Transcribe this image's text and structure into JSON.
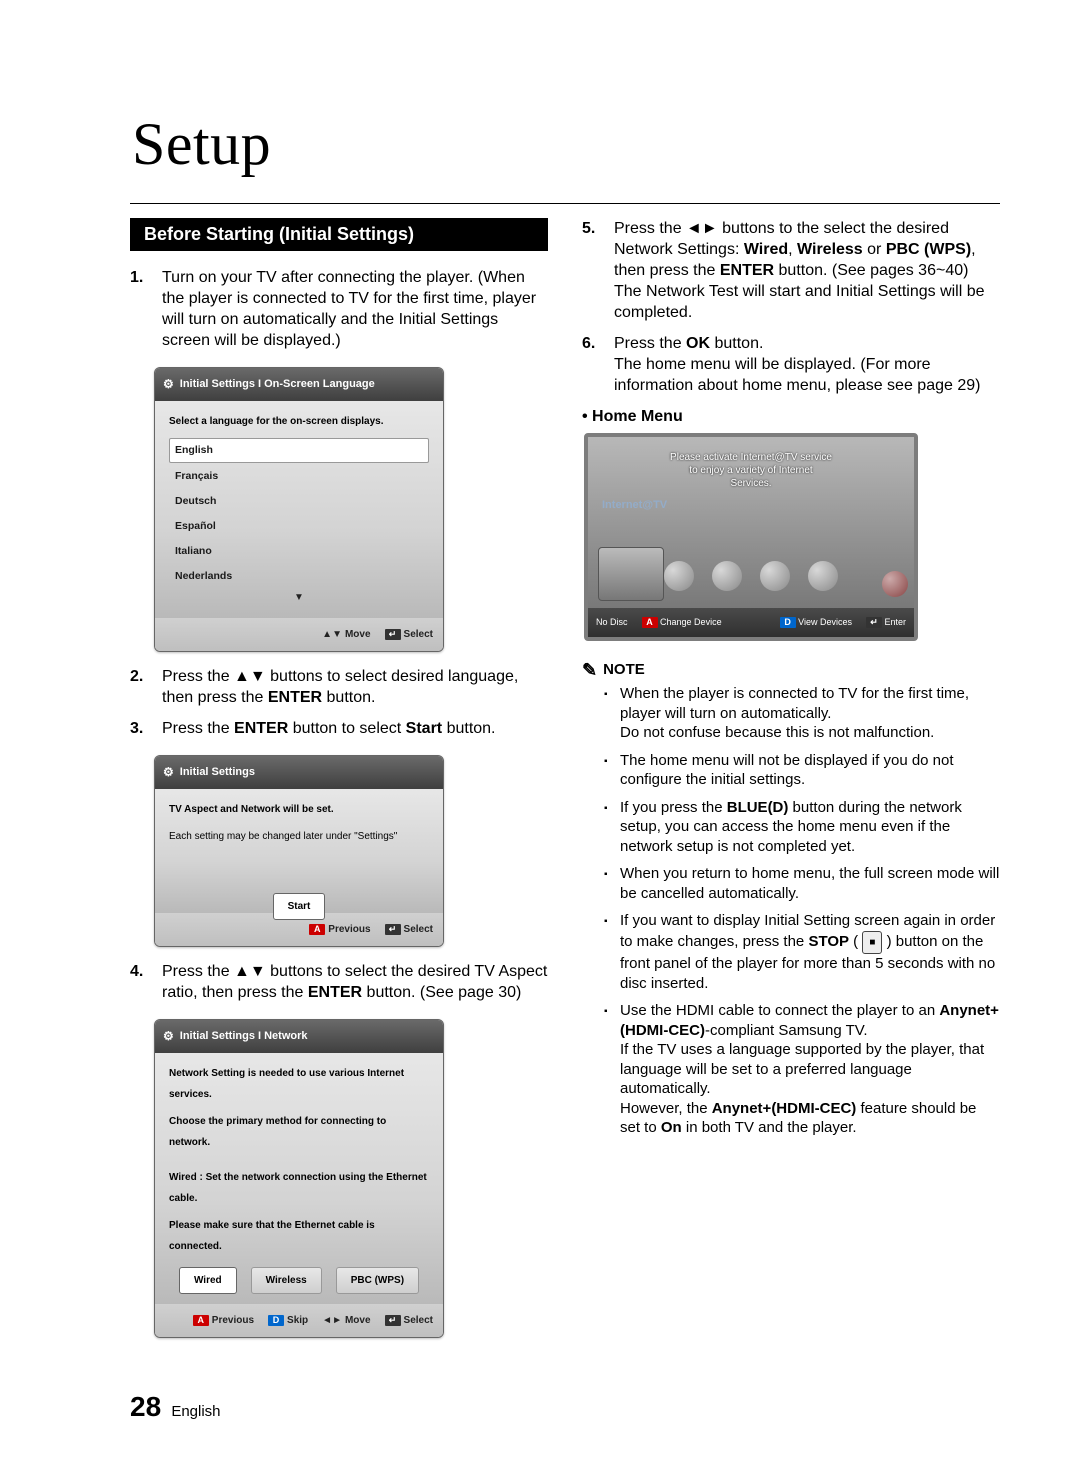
{
  "page": {
    "title": "Setup",
    "number": "28",
    "language": "English"
  },
  "section_heading": "Before Starting (Initial Settings)",
  "steps_left": [
    "Turn on your TV after connecting the player. (When the player is connected to TV for the first time, player will turn on automatically and the Initial Settings screen will be displayed.)",
    "Press the ▲▼ buttons to select desired language, then press the ENTER button.",
    "Press the ENTER button to select Start button.",
    "Press the ▲▼ buttons to select the desired TV Aspect ratio, then press the ENTER button. (See page 30)"
  ],
  "steps_right": [
    "Press the ◄► buttons to the select the desired Network Settings: Wired, Wireless or PBC (WPS), then press the ENTER button. (See pages 36~40)  The Network Test will start and Initial Settings will be completed.",
    "Press the OK button.  The home menu will be displayed. (For more information about home menu, please see page 29)"
  ],
  "bold_words": {
    "enter": "ENTER",
    "start": "Start",
    "ok": "OK",
    "wired": "Wired",
    "wireless": "Wireless",
    "pbc": "PBC (WPS)",
    "blue_d": "BLUE(D)",
    "stop": "STOP",
    "anynet": "Anynet+(HDMI-CEC)",
    "on": "On"
  },
  "osd1": {
    "title": "Initial Settings I On-Screen Language",
    "msg": "Select a language for the on-screen displays.",
    "languages": [
      "English",
      "Français",
      "Deutsch",
      "Español",
      "Italiano",
      "Nederlands"
    ],
    "footer_move": "Move",
    "footer_select": "Select"
  },
  "osd2": {
    "title": "Initial Settings",
    "msg1": "TV Aspect and Network will be set.",
    "msg2": "Each setting may be changed later under \"Settings\"",
    "btn_start": "Start",
    "footer_previous": "Previous",
    "footer_select": "Select"
  },
  "osd3": {
    "title": "Initial Settings I Network",
    "msg1": "Network Setting is needed to use various Internet services.",
    "msg2": "Choose the primary method for connecting to network.",
    "msg3": "Wired : Set the network connection using the Ethernet cable.",
    "msg4": "Please make sure that the Ethernet cable is connected.",
    "btn_wired": "Wired",
    "btn_wireless": "Wireless",
    "btn_pbc": "PBC (WPS)",
    "footer_previous": "Previous",
    "footer_skip": "Skip",
    "footer_move": "Move",
    "footer_select": "Select"
  },
  "home_menu_label": "• Home Menu",
  "home": {
    "banner1": "Please activate Internet@TV service",
    "banner2": "to enjoy a variety of Internet Services.",
    "itv": "Internet@TV",
    "footer_nodisc": "No Disc",
    "footer_change": "Change Device",
    "footer_view": "View Devices",
    "footer_enter": "Enter"
  },
  "note_label": "NOTE",
  "notes": [
    "When the player is connected to TV for the first time, player will turn on automatically.  Do not confuse because this is not malfunction.",
    "The home menu will not be displayed if you do not configure the initial settings.",
    "If you press the BLUE(D) button during the network setup, you can access the home menu even if the network setup is not completed yet.",
    "When you return to home menu, the full screen mode will be cancelled automatically.",
    "If you want to display Initial Setting screen again in order to make changes, press the STOP (  ■  ) button on the front panel of the player for more than 5 seconds with no disc inserted.",
    "Use the HDMI cable to connect the player to an Anynet+(HDMI-CEC)-compliant Samsung TV.  If the TV uses a language supported by the player, that language will be set to a preferred language automatically.  However, the Anynet+(HDMI-CEC) feature should be set to On in both TV and the player."
  ]
}
